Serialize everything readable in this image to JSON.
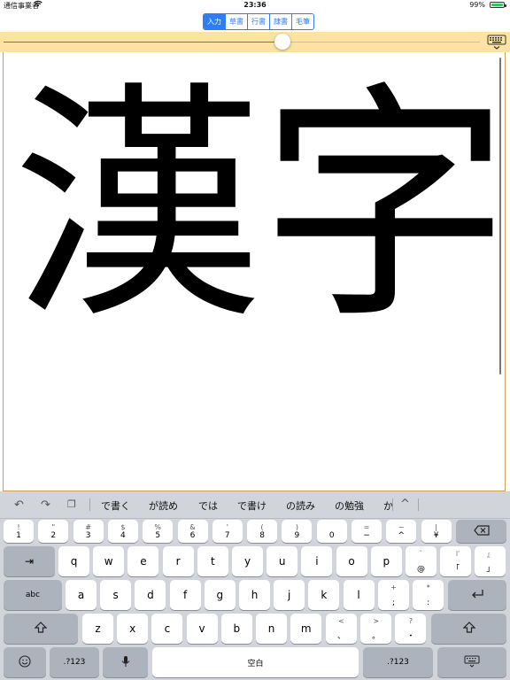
{
  "status_bar": {
    "carrier": "通信事業者",
    "time": "23:36",
    "battery_percent": "99%",
    "battery_level": 0.99
  },
  "mode_tabs": [
    {
      "label": "入力",
      "active": true
    },
    {
      "label": "草書",
      "active": false
    },
    {
      "label": "行書",
      "active": false
    },
    {
      "label": "隷書",
      "active": false
    },
    {
      "label": "毛筆",
      "active": false
    }
  ],
  "slider": {
    "value": 0.585
  },
  "canvas": {
    "text1": "漢",
    "text2": "字"
  },
  "predictions": [
    "で書く",
    "が読め",
    "では",
    "で書け",
    "の読み",
    "の勉強",
    "か"
  ],
  "keyboard": {
    "row1": [
      {
        "top": "!",
        "bot": "1"
      },
      {
        "top": "\"",
        "bot": "2"
      },
      {
        "top": "#",
        "bot": "3"
      },
      {
        "top": "$",
        "bot": "4"
      },
      {
        "top": "%",
        "bot": "5"
      },
      {
        "top": "&",
        "bot": "6"
      },
      {
        "top": "'",
        "bot": "7"
      },
      {
        "top": "(",
        "bot": "8"
      },
      {
        "top": ")",
        "bot": "9"
      },
      {
        "top": "",
        "bot": "0"
      },
      {
        "top": "=",
        "bot": "−"
      },
      {
        "top": "~",
        "bot": "^"
      },
      {
        "top": "|",
        "bot": "¥"
      }
    ],
    "row2": [
      "q",
      "w",
      "e",
      "r",
      "t",
      "y",
      "u",
      "i",
      "o",
      "p"
    ],
    "row2_extra": [
      {
        "top": "`",
        "bot": "@"
      },
      {
        "top": "『",
        "bot": "「"
      },
      {
        "top": "』",
        "bot": "」"
      }
    ],
    "row3": [
      "a",
      "s",
      "d",
      "f",
      "g",
      "h",
      "j",
      "k",
      "l"
    ],
    "row3_extra": [
      {
        "top": "+",
        "bot": ";"
      },
      {
        "top": "*",
        "bot": ":"
      }
    ],
    "row4": [
      "z",
      "x",
      "c",
      "v",
      "b",
      "n",
      "m"
    ],
    "row4_extra": [
      {
        "top": "<",
        "bot": "、"
      },
      {
        "top": ">",
        "bot": "。"
      },
      {
        "top": "?",
        "bot": "・"
      }
    ],
    "tab_label": "⇥",
    "abc_label": "abc",
    "num_label_left": ".?123",
    "num_label_right": ".?123",
    "space_label": "空白"
  },
  "colors": {
    "accent": "#2f7cf6",
    "toolbar_bg": "#fce3a4",
    "keyboard_bg": "#d1d4da"
  }
}
